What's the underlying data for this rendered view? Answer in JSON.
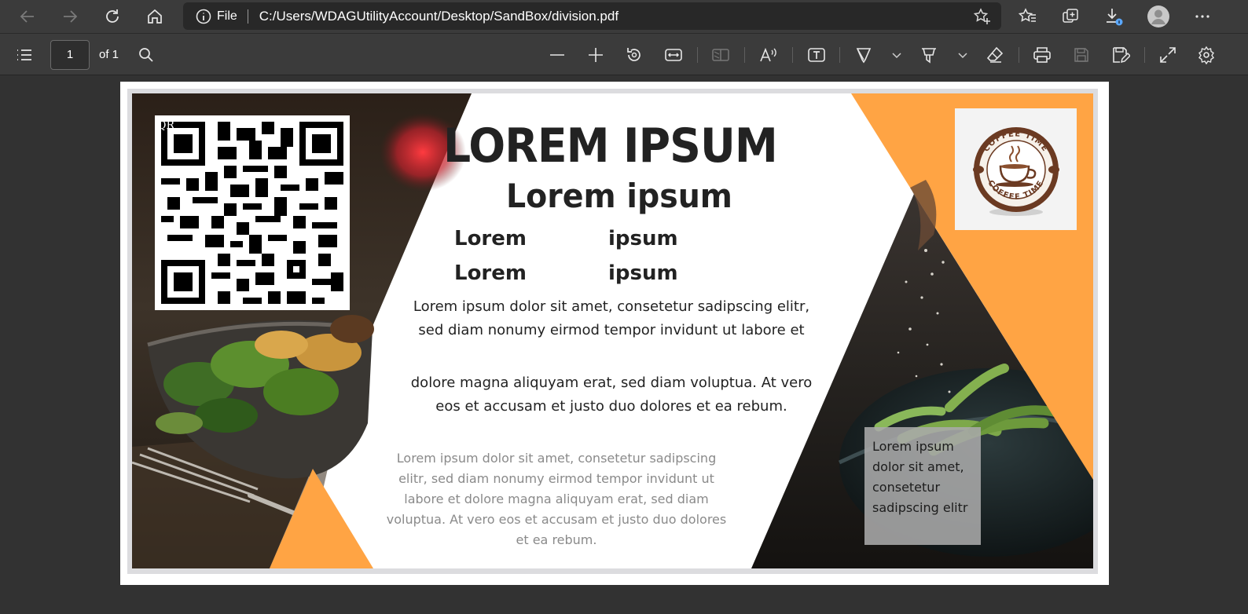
{
  "browser": {
    "address_scheme": "File",
    "address_url": "C:/Users/WDAGUtilityAccount/Desktop/SandBox/division.pdf",
    "icons": [
      "back-arrow-icon",
      "forward-arrow-icon",
      "refresh-icon",
      "home-icon",
      "info-icon",
      "add-favorite-icon",
      "favorites-icon",
      "collections-icon",
      "downloads-icon",
      "profile-icon",
      "more-icon"
    ]
  },
  "pdf_toolbar": {
    "page_number": "1",
    "page_total": "of 1",
    "icons": [
      "contents-icon",
      "search-icon",
      "zoom-out-icon",
      "zoom-in-icon",
      "rotate-icon",
      "fit-width-icon",
      "page-view-icon",
      "read-aloud-icon",
      "text-box-icon",
      "draw-icon",
      "highlight-icon",
      "eraser-icon",
      "print-icon",
      "save-icon",
      "save-as-icon",
      "fullscreen-icon",
      "settings-icon"
    ]
  },
  "document": {
    "heading": "LOREM IPSUM",
    "subheading": "Lorem ipsum",
    "label_left_1": "Lorem",
    "label_right_1": "ipsum",
    "label_left_2": "Lorem",
    "label_right_2": "ipsum",
    "paragraph_1": "Lorem ipsum dolor sit amet, consetetur sadipscing elitr, sed diam nonumy eirmod tempor invidunt ut labore et",
    "paragraph_2": "dolore magna aliquyam erat, sed diam voluptua. At vero eos et accusam et justo duo dolores et ea rebum.",
    "paragraph_3": "Lorem ipsum dolor sit amet, consetetur sadipscing elitr, sed diam nonumy eirmod tempor invidunt ut labore et dolore magna aliquyam erat, sed diam voluptua. At vero eos et accusam et justo duo dolores et ea rebum.",
    "qr_label": "QR",
    "logo_text_top": "COFFEE TIME",
    "logo_text_bottom": "COFFEE TIME",
    "note": "Lorem ipsum dolor sit amet, consetetur sadipscing elitr",
    "colors": {
      "accent_orange": "#FFA444",
      "text_dark": "#222222",
      "text_muted": "#8A8A8A",
      "coffee_brown": "#6B3A22"
    }
  }
}
